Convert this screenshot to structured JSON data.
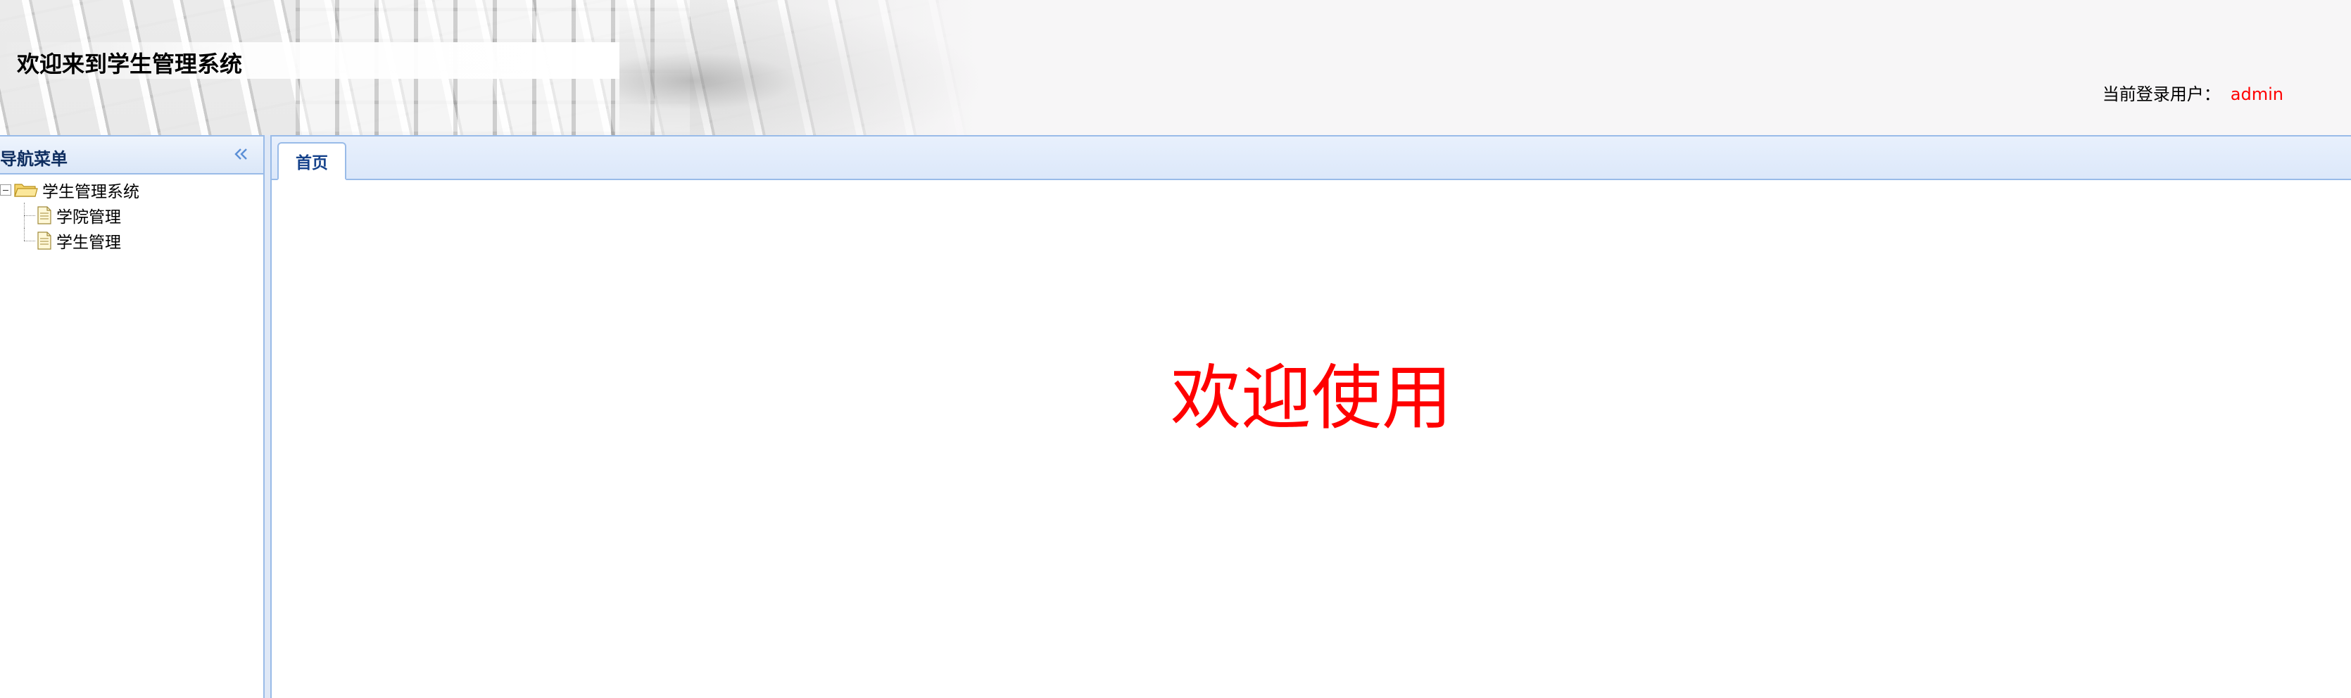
{
  "header": {
    "title": "欢迎来到学生管理系统",
    "user_label": "当前登录用户：",
    "user_name": "admin"
  },
  "nav": {
    "title": "导航菜单",
    "collapse_icon": "double-chevron-left-icon",
    "tree": {
      "root_label": "学生管理系统",
      "root_icon": "folder-open-icon",
      "children": [
        {
          "label": "学院管理",
          "icon": "document-icon"
        },
        {
          "label": "学生管理",
          "icon": "document-icon"
        }
      ]
    }
  },
  "tabs": [
    {
      "label": "首页",
      "active": true
    }
  ],
  "content": {
    "welcome": "欢迎使用"
  },
  "colors": {
    "accent_border": "#99bbe8",
    "title_blue": "#15428b",
    "welcome_red": "#ff0000"
  }
}
